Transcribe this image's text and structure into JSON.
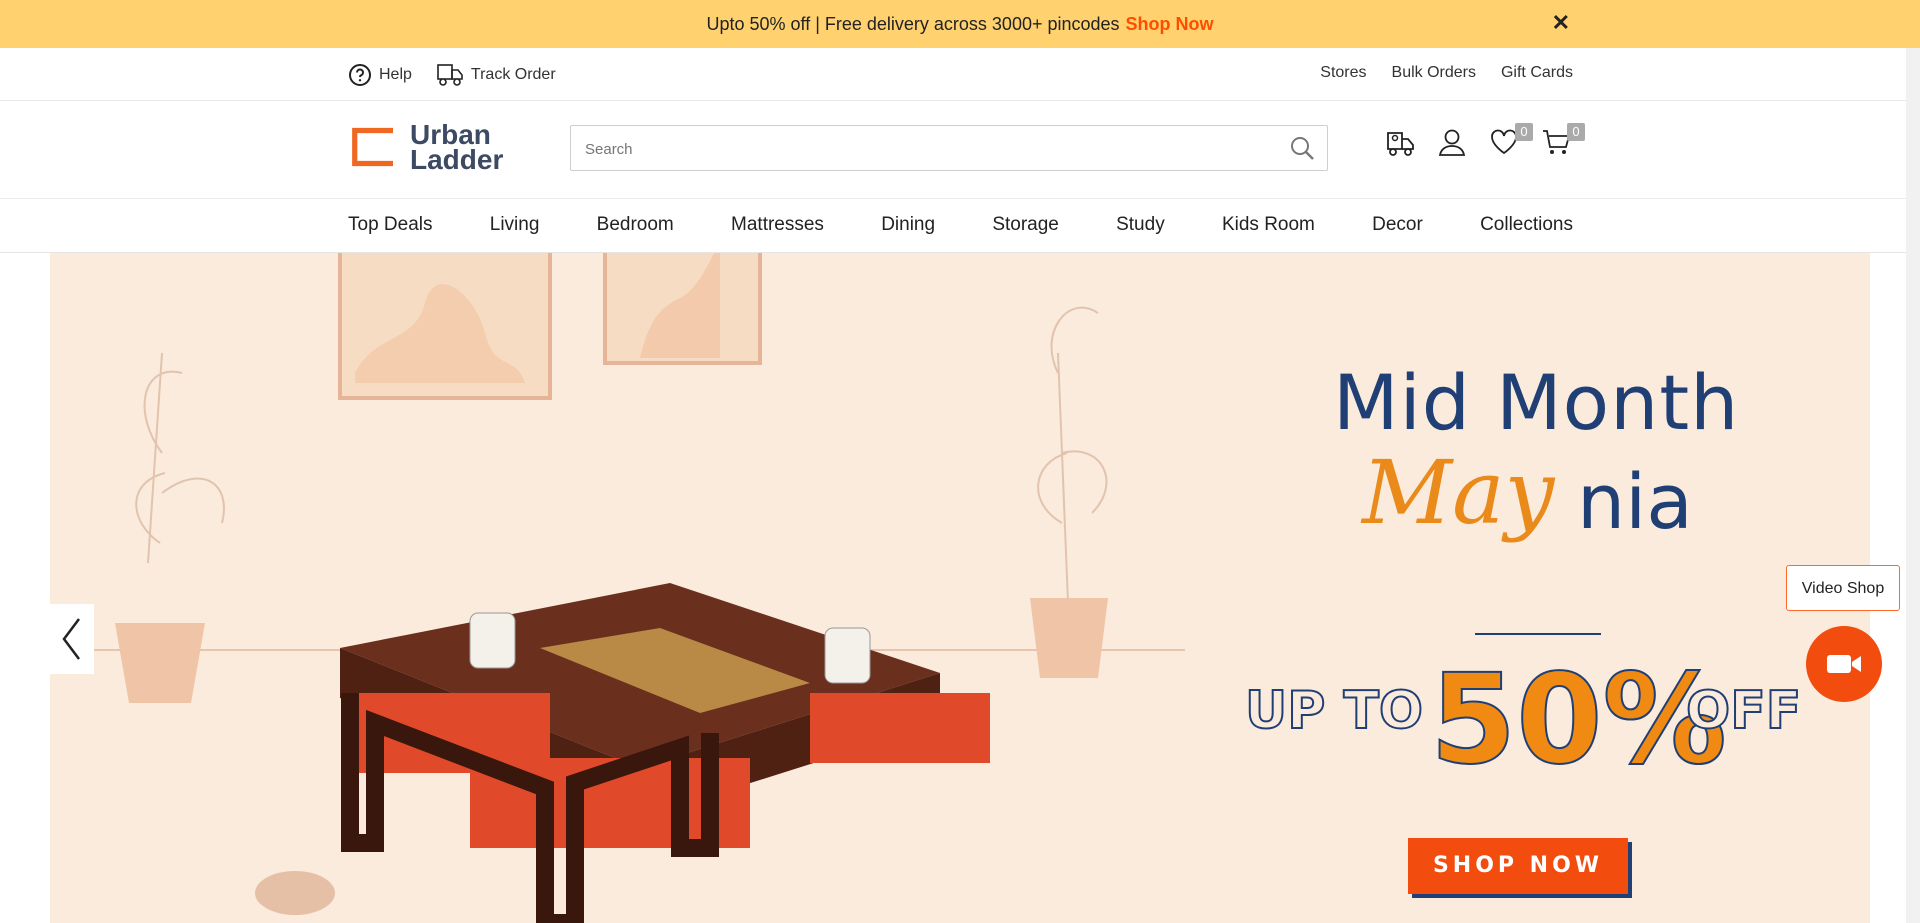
{
  "announcement": {
    "text": "Upto 50% off | Free delivery across 3000+ pincodes",
    "link": "Shop Now",
    "close": "✕"
  },
  "utility": {
    "help": "Help",
    "track": "Track Order",
    "stores": "Stores",
    "bulk": "Bulk Orders",
    "gift": "Gift Cards"
  },
  "brand": {
    "line1": "Urban",
    "line2": "Ladder"
  },
  "search": {
    "placeholder": "Search"
  },
  "header_icons": {
    "wishlist_count": "0",
    "cart_count": "0"
  },
  "nav": [
    "Top Deals",
    "Living",
    "Bedroom",
    "Mattresses",
    "Dining",
    "Storage",
    "Study",
    "Kids Room",
    "Decor",
    "Collections"
  ],
  "hero": {
    "line1": "Mid Month",
    "line2a": "May",
    "line2b": "nia",
    "offer_pre": "UP TO",
    "offer_num": "50%",
    "offer_post": "OFF",
    "cta": "SHOP NOW"
  },
  "video": {
    "label": "Video Shop"
  },
  "colors": {
    "announcement_bg": "#ffd26f",
    "accent": "#f24c0f",
    "hero_bg": "#fbebdc",
    "navy": "#1f3f75"
  }
}
